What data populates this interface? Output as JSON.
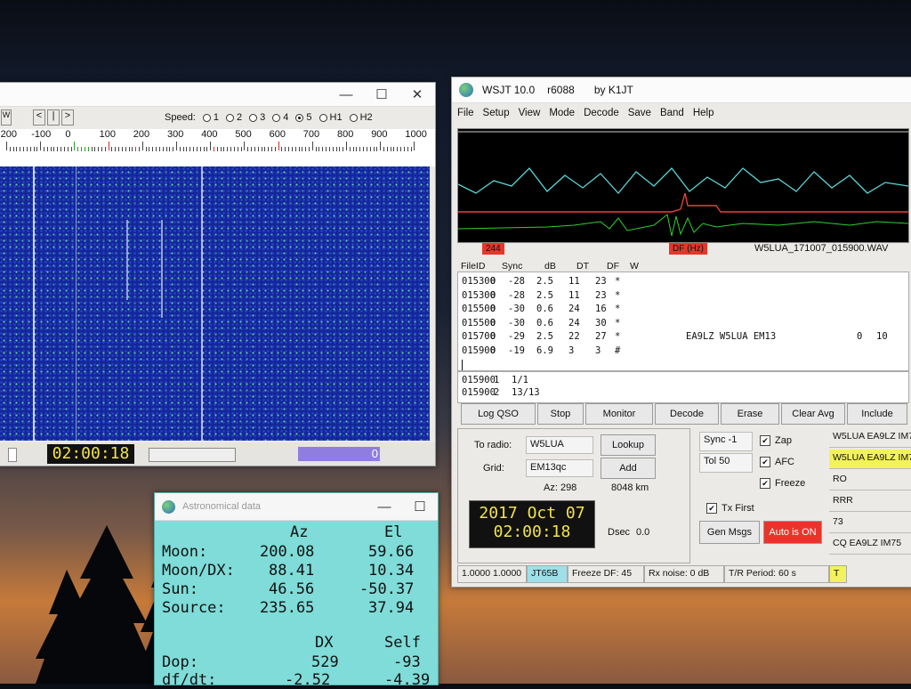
{
  "waterfall": {
    "speed_label": "Speed:",
    "speeds": [
      "1",
      "2",
      "3",
      "4",
      "5",
      "H1",
      "H2"
    ],
    "speed_selected": "5",
    "nav_buttons": [
      "W",
      "<",
      "|",
      ">"
    ],
    "scale_labels": [
      "-200",
      "-100",
      "0",
      "100",
      "200",
      "300",
      "400",
      "500",
      "600",
      "700",
      "800",
      "900",
      "1000"
    ],
    "time": "02:00:18",
    "level": "0"
  },
  "wsjt": {
    "title": "WSJT 10.0",
    "revision": "r6088",
    "author": "by K1JT",
    "menu": [
      "File",
      "Setup",
      "View",
      "Mode",
      "Decode",
      "Save",
      "Band",
      "Help"
    ],
    "marker_left": "244",
    "marker_df": "DF (Hz)",
    "wav_file": "W5LUA_171007_015900.WAV",
    "table_headers": [
      "FileID",
      "Sync",
      "dB",
      "DT",
      "DF",
      "W"
    ],
    "decodes": [
      {
        "file": "015300",
        "sync": "0",
        "db": "-28",
        "dt": "2.5",
        "df": "11",
        "w": "23",
        "flag": "*",
        "msg": "",
        "extra1": "",
        "extra2": ""
      },
      {
        "file": "015300",
        "sync": "0",
        "db": "-28",
        "dt": "2.5",
        "df": "11",
        "w": "23",
        "flag": "*",
        "msg": "",
        "extra1": "",
        "extra2": ""
      },
      {
        "file": "015500",
        "sync": "0",
        "db": "-30",
        "dt": "0.6",
        "df": "24",
        "w": "16",
        "flag": "*",
        "msg": "",
        "extra1": "",
        "extra2": ""
      },
      {
        "file": "015500",
        "sync": "0",
        "db": "-30",
        "dt": "0.6",
        "df": "24",
        "w": "30",
        "flag": "*",
        "msg": "",
        "extra1": "",
        "extra2": ""
      },
      {
        "file": "015700",
        "sync": "0",
        "db": "-29",
        "dt": "2.5",
        "df": "22",
        "w": "27",
        "flag": "*",
        "msg": "EA9LZ W5LUA EM13",
        "extra1": "0",
        "extra2": "10"
      },
      {
        "file": "015900",
        "sync": "0",
        "db": "-19",
        "dt": "6.9",
        "df": "3",
        "w": "3",
        "flag": "#",
        "msg": "",
        "extra1": "",
        "extra2": ""
      }
    ],
    "avg": [
      {
        "file": "015900",
        "n": "1",
        "ratio": "1/1"
      },
      {
        "file": "015900",
        "n": "2",
        "ratio": "13/13"
      }
    ],
    "buttons": {
      "log_qso": "Log QSO",
      "stop": "Stop",
      "monitor": "Monitor",
      "decode": "Decode",
      "erase": "Erase",
      "clear_avg": "Clear Avg",
      "include": "Include",
      "lookup": "Lookup",
      "add": "Add",
      "gen_msgs": "Gen Msgs",
      "auto": "Auto is  ON"
    },
    "to_radio_label": "To radio:",
    "to_radio": "W5LUA",
    "grid_label": "Grid:",
    "grid": "EM13qc",
    "az": "Az: 298",
    "dist": "8048 km",
    "date": "2017 Oct 07",
    "clock": "02:00:18",
    "dsec_label": "Dsec",
    "dsec": "0.0",
    "sync_label": "Sync",
    "sync_val": "-1",
    "tol_label": "Tol",
    "tol_val": "50",
    "zap": "Zap",
    "afc": "AFC",
    "freeze": "Freeze",
    "tx_first": "Tx First",
    "right_msgs": [
      "W5LUA EA9LZ IM7",
      "W5LUA EA9LZ IM7",
      "RO",
      "RRR",
      "73",
      "CQ EA9LZ IM75"
    ],
    "status": [
      "1.0000 1.0000",
      "JT65B",
      "Freeze DF:  45",
      "Rx noise:  0 dB",
      "T/R Period: 60 s",
      "T"
    ],
    "colors": {
      "accent_red": "#e8352b",
      "mode_cyan": "#9fe0e8",
      "highlight_yellow": "#f2f25a"
    }
  },
  "astro": {
    "title": "Astronomical data",
    "col_az": "Az",
    "col_el": "El",
    "rows": [
      {
        "label": "Moon:",
        "az": "200.08",
        "el": "59.66"
      },
      {
        "label": "Moon/DX:",
        "az": "88.41",
        "el": "10.34"
      },
      {
        "label": "Sun:",
        "az": "46.56",
        "el": "-50.37"
      },
      {
        "label": "Source:",
        "az": "235.65",
        "el": "37.94"
      }
    ],
    "col_dx": "DX",
    "col_self": "Self",
    "dop_label": "Dop:",
    "dop_dx": "529",
    "dop_self": "-93",
    "dfdt_label": "df/dt:",
    "dfdt_dx": "-2.52",
    "dfdt_self": "-4.39"
  }
}
